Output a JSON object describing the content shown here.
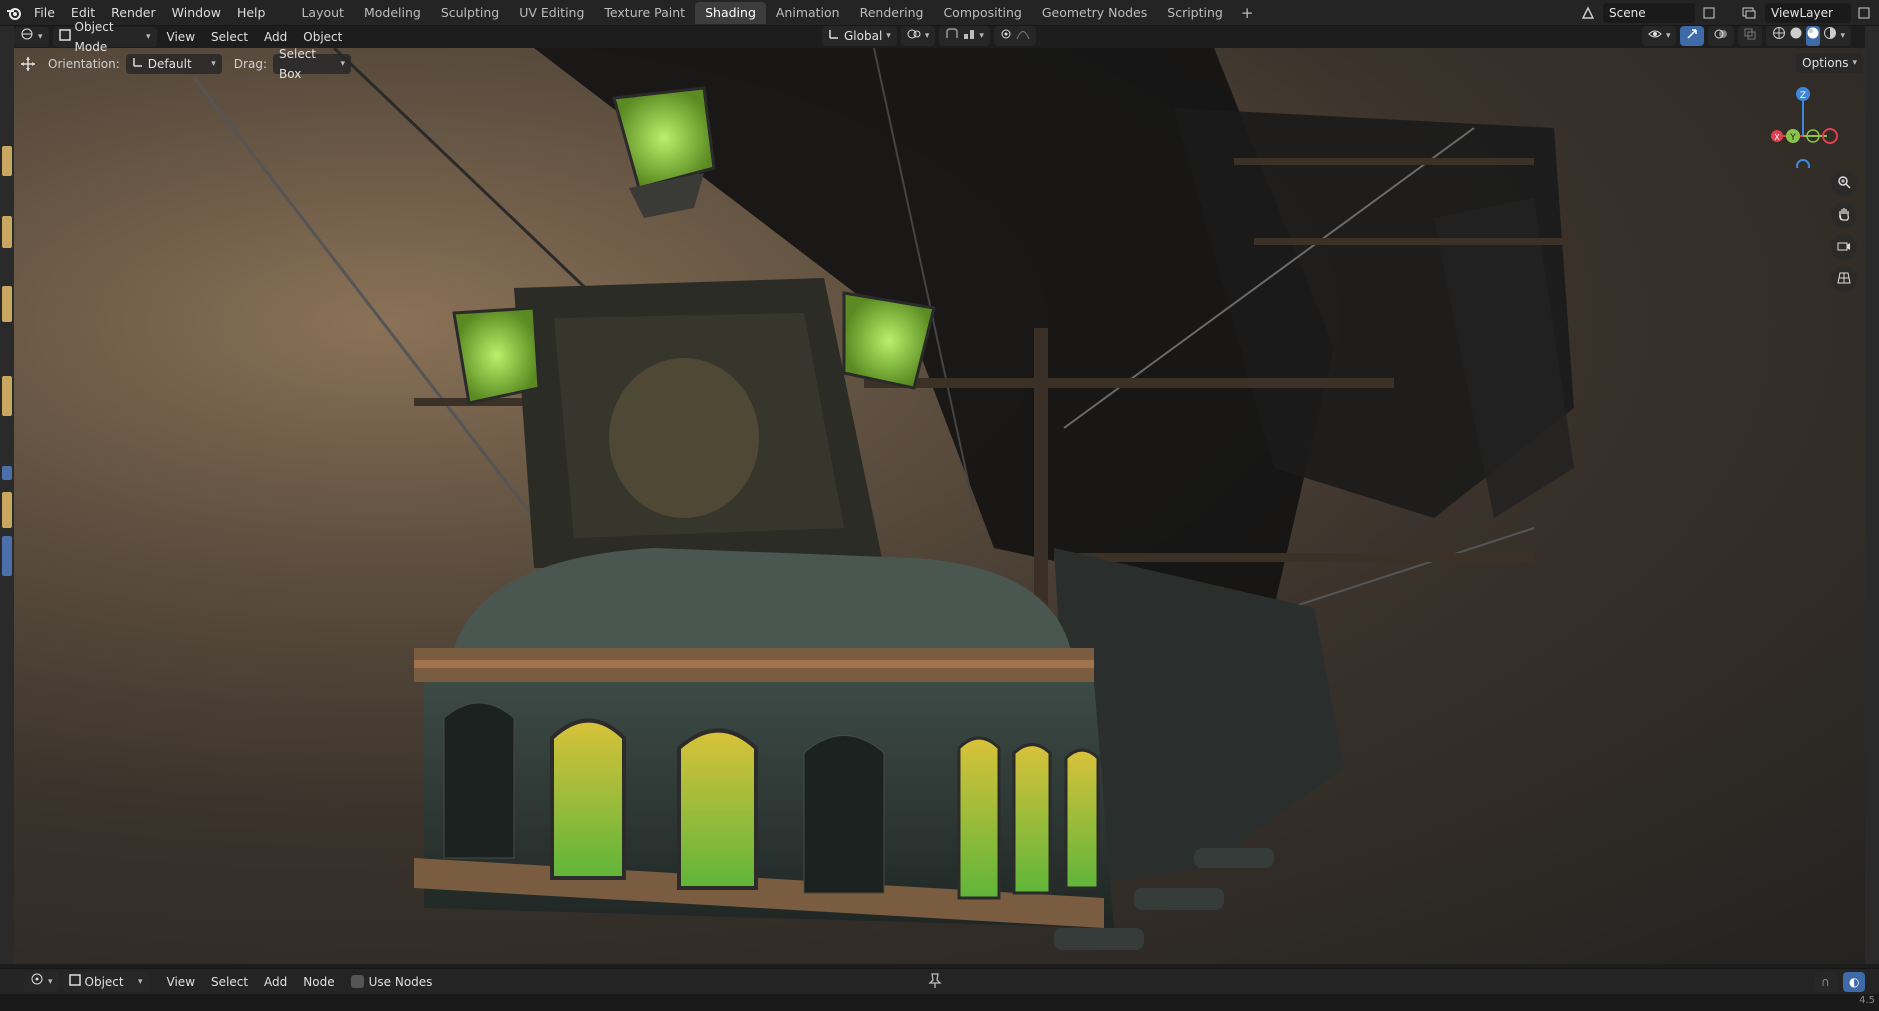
{
  "menu": {
    "items": [
      "File",
      "Edit",
      "Render",
      "Window",
      "Help"
    ]
  },
  "workspaces": {
    "tabs": [
      "Layout",
      "Modeling",
      "Sculpting",
      "UV Editing",
      "Texture Paint",
      "Shading",
      "Animation",
      "Rendering",
      "Compositing",
      "Geometry Nodes",
      "Scripting"
    ],
    "active": "Shading",
    "add_label": "+"
  },
  "top_right": {
    "scene_label": "Scene",
    "view_layer_label": "ViewLayer"
  },
  "viewport_header": {
    "mode": "Object Mode",
    "menus": [
      "View",
      "Select",
      "Add",
      "Object"
    ],
    "transform_orientation": "Global"
  },
  "tool_settings": {
    "orientation_label": "Orientation:",
    "orientation_value": "Default",
    "drag_label": "Drag:",
    "drag_value": "Select Box",
    "options_label": "Options"
  },
  "gizmo": {
    "z_label": "Z",
    "y_label": "Y",
    "x_label": "X",
    "colors": {
      "x": "#e0404f",
      "y": "#8bc34a",
      "z": "#3d87d8"
    }
  },
  "bottom_header": {
    "context": "Object",
    "menus": [
      "View",
      "Select",
      "Add",
      "Node"
    ],
    "use_nodes_label": "Use Nodes"
  },
  "status": {
    "version_fragment": "4.5"
  },
  "icons": [
    "blender-logo-icon",
    "editor-type-icon",
    "object-mode-icon",
    "orientation-icon",
    "snap-icon",
    "proportional-icon",
    "overlay-icon",
    "shading-solid-icon",
    "shading-material-icon",
    "shading-rendered-icon",
    "zoom-icon",
    "hand-icon",
    "camera-icon",
    "grid-icon",
    "pin-icon"
  ]
}
